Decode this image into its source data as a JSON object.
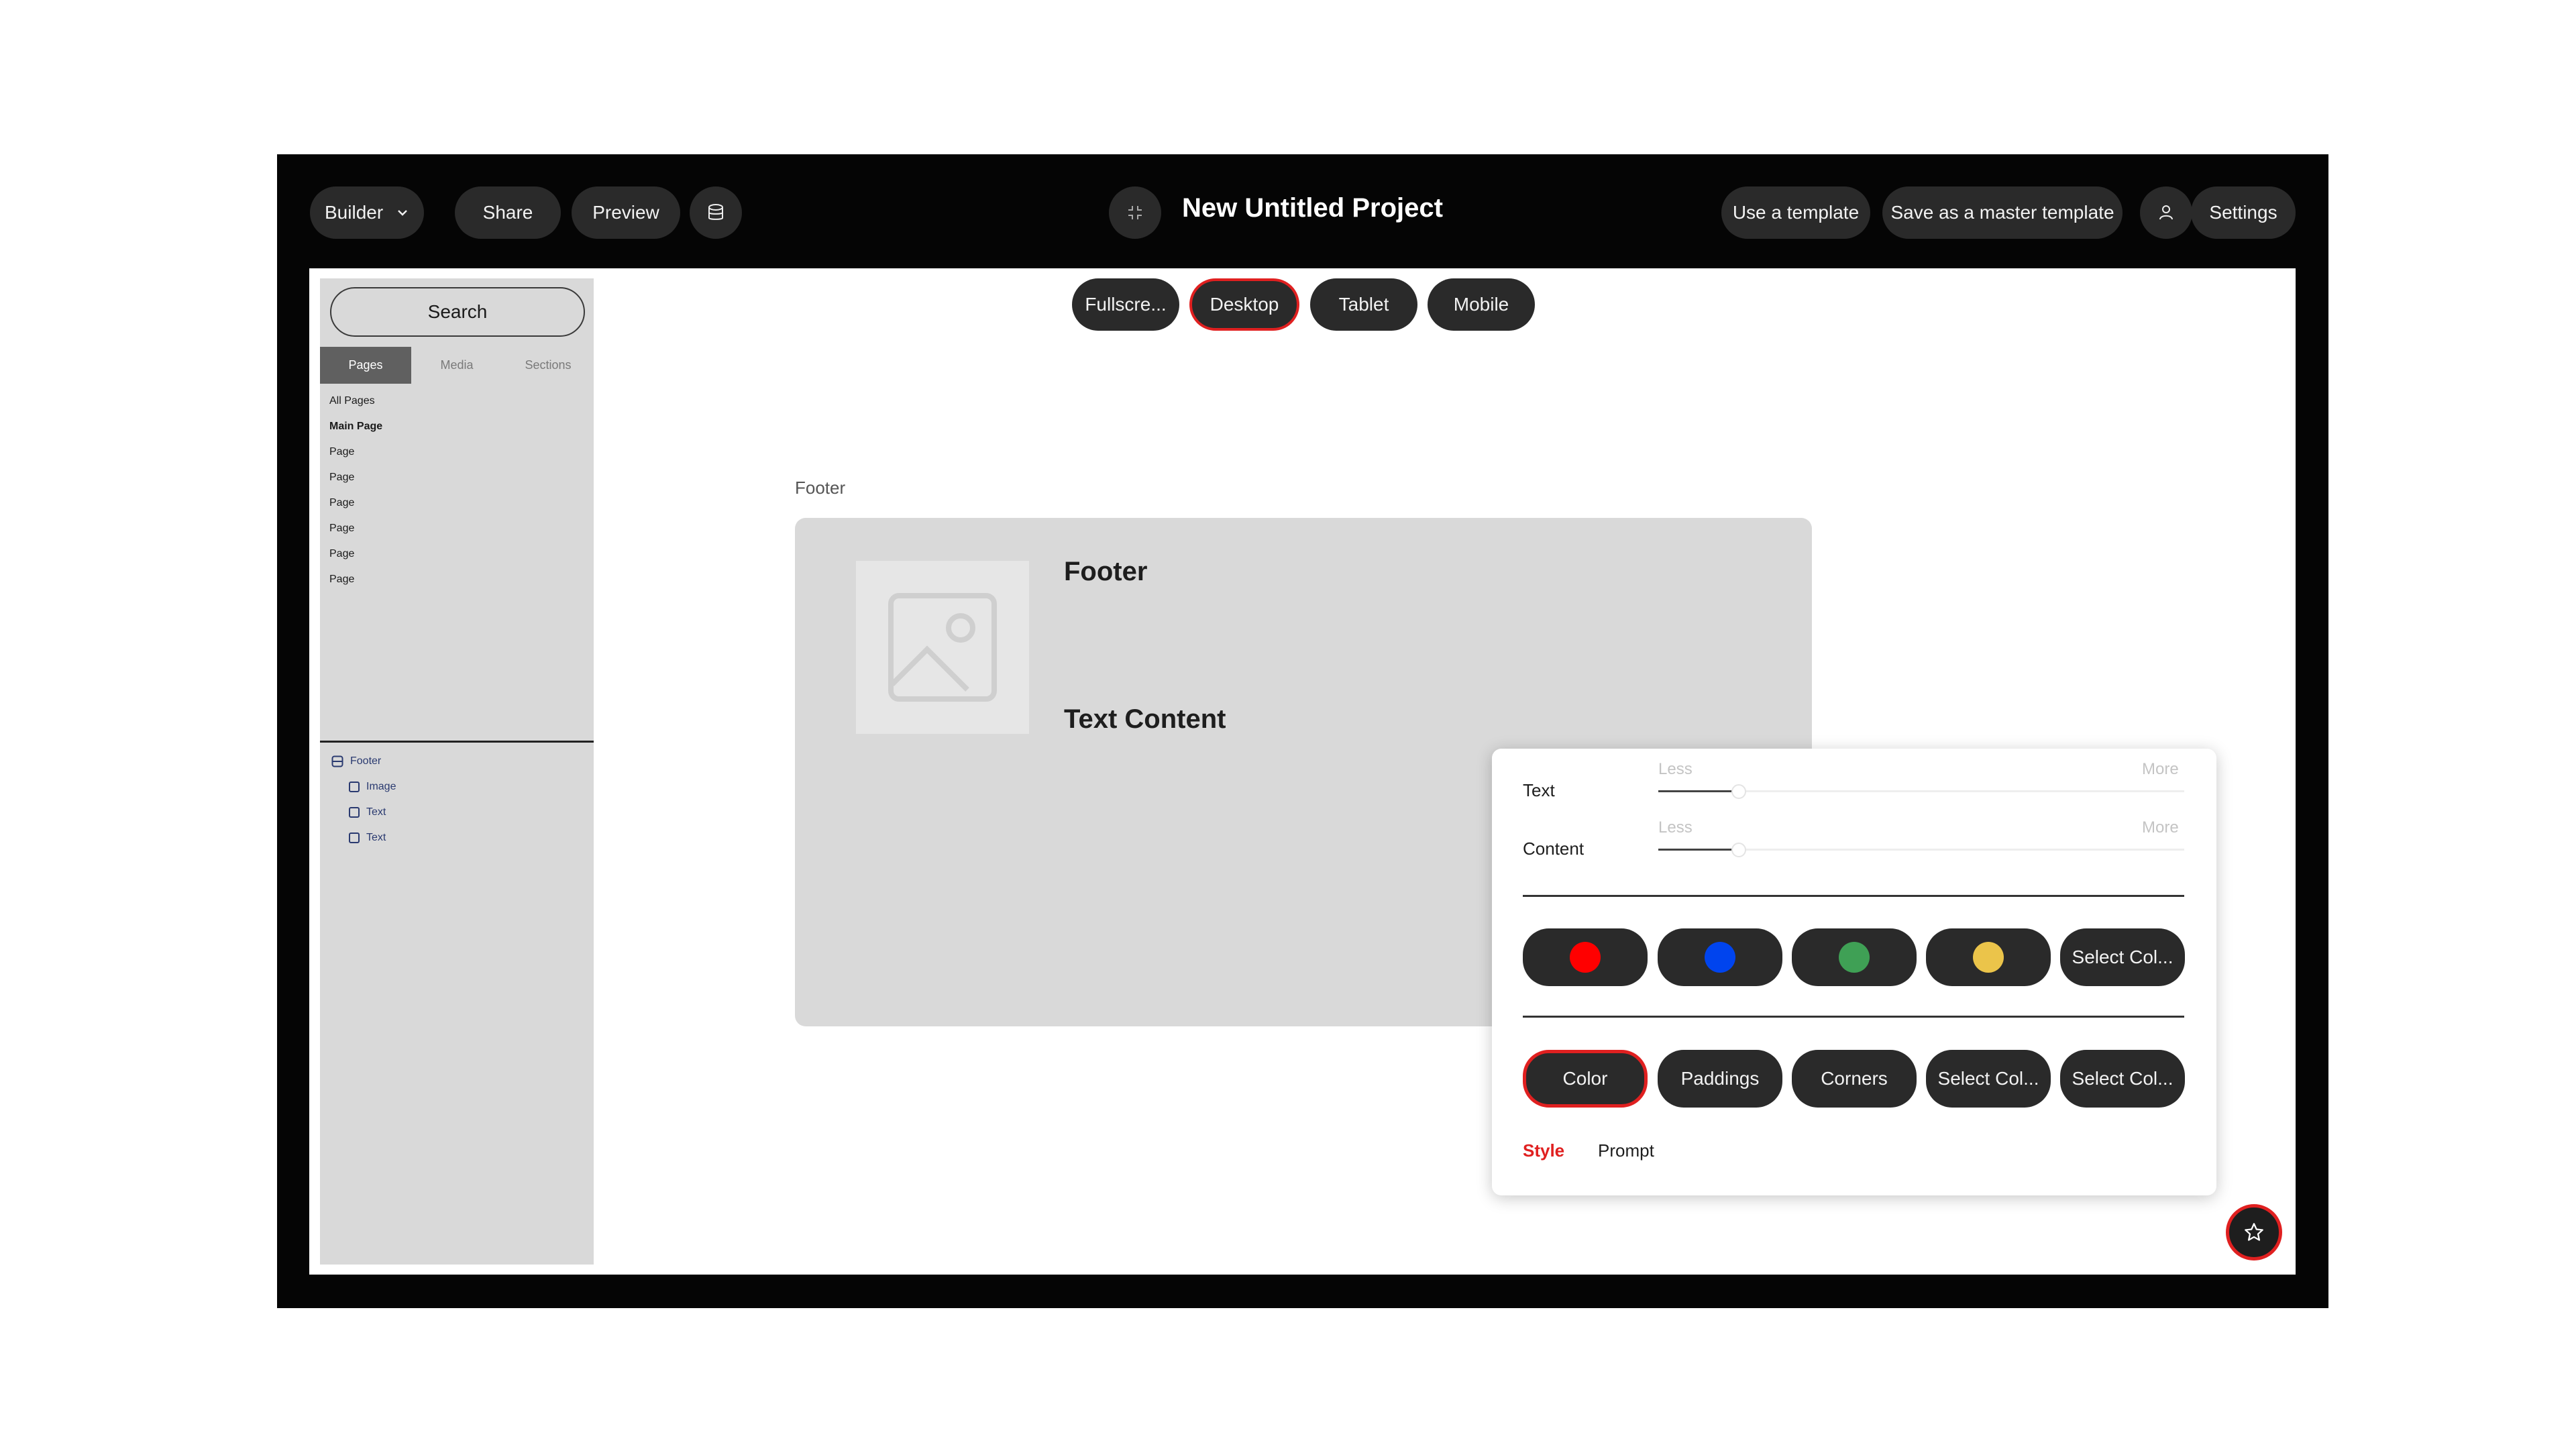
{
  "topbar": {
    "builder_label": "Builder",
    "share_label": "Share",
    "preview_label": "Preview",
    "project_title": "New Untitled Project",
    "use_template_label": "Use a template",
    "save_master_label": "Save as a master template",
    "settings_label": "Settings"
  },
  "sidebar": {
    "search_label": "Search",
    "tabs": [
      "Pages",
      "Media",
      "Sections"
    ],
    "active_tab": "Pages",
    "pages": [
      "All Pages",
      "Main Page",
      "Page",
      "Page",
      "Page",
      "Page",
      "Page",
      "Page"
    ],
    "tree": {
      "root": "Footer",
      "children": [
        "Image",
        "Text",
        "Text"
      ]
    }
  },
  "device_tabs": {
    "items": [
      "Fullscre...",
      "Desktop",
      "Tablet",
      "Mobile"
    ],
    "active": "Desktop"
  },
  "canvas": {
    "section_caption": "Footer",
    "card_title": "Footer",
    "card_text": "Text Content"
  },
  "style_panel": {
    "sliders": [
      {
        "label": "Text",
        "min_label": "Less",
        "max_label": "More",
        "level": 0.14
      },
      {
        "label": "Content",
        "min_label": "Less",
        "max_label": "More",
        "level": 0.14
      }
    ],
    "swatches": [
      {
        "color": "#ff0000"
      },
      {
        "color": "#0044ee"
      },
      {
        "color": "#3fa055"
      },
      {
        "color": "#ebc44a"
      },
      {
        "label": "Select Col..."
      }
    ],
    "options": [
      "Color",
      "Paddings",
      "Corners",
      "Select Col...",
      "Select Col..."
    ],
    "active_option": "Color",
    "tabs": [
      "Style",
      "Prompt"
    ],
    "active_tab": "Style"
  },
  "colors": {
    "accent": "#e02020",
    "frame": "#050505",
    "pill": "#2a2a2a"
  }
}
